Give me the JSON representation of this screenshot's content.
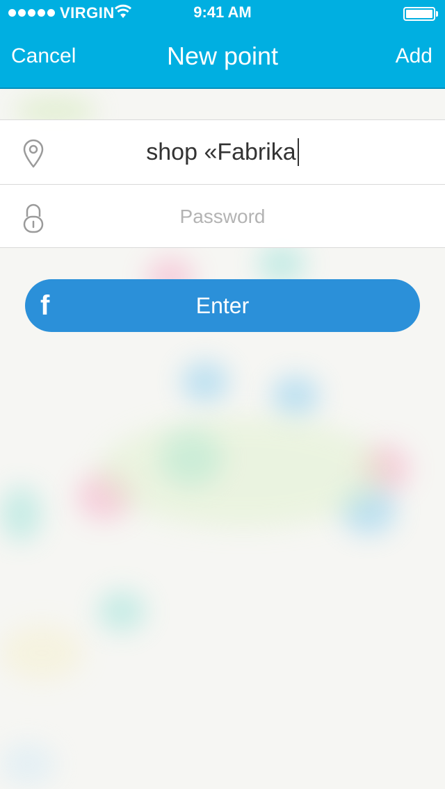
{
  "status_bar": {
    "carrier": "VIRGIN",
    "time": "9:41 AM"
  },
  "nav": {
    "cancel_label": "Cancel",
    "title": "New point",
    "add_label": "Add"
  },
  "form": {
    "location_value": "shop «Fabrika",
    "password_placeholder": "Password"
  },
  "enter_button": {
    "label": "Enter",
    "icon": "f"
  },
  "colors": {
    "header": "#00afe1",
    "button": "#2b90d9"
  }
}
